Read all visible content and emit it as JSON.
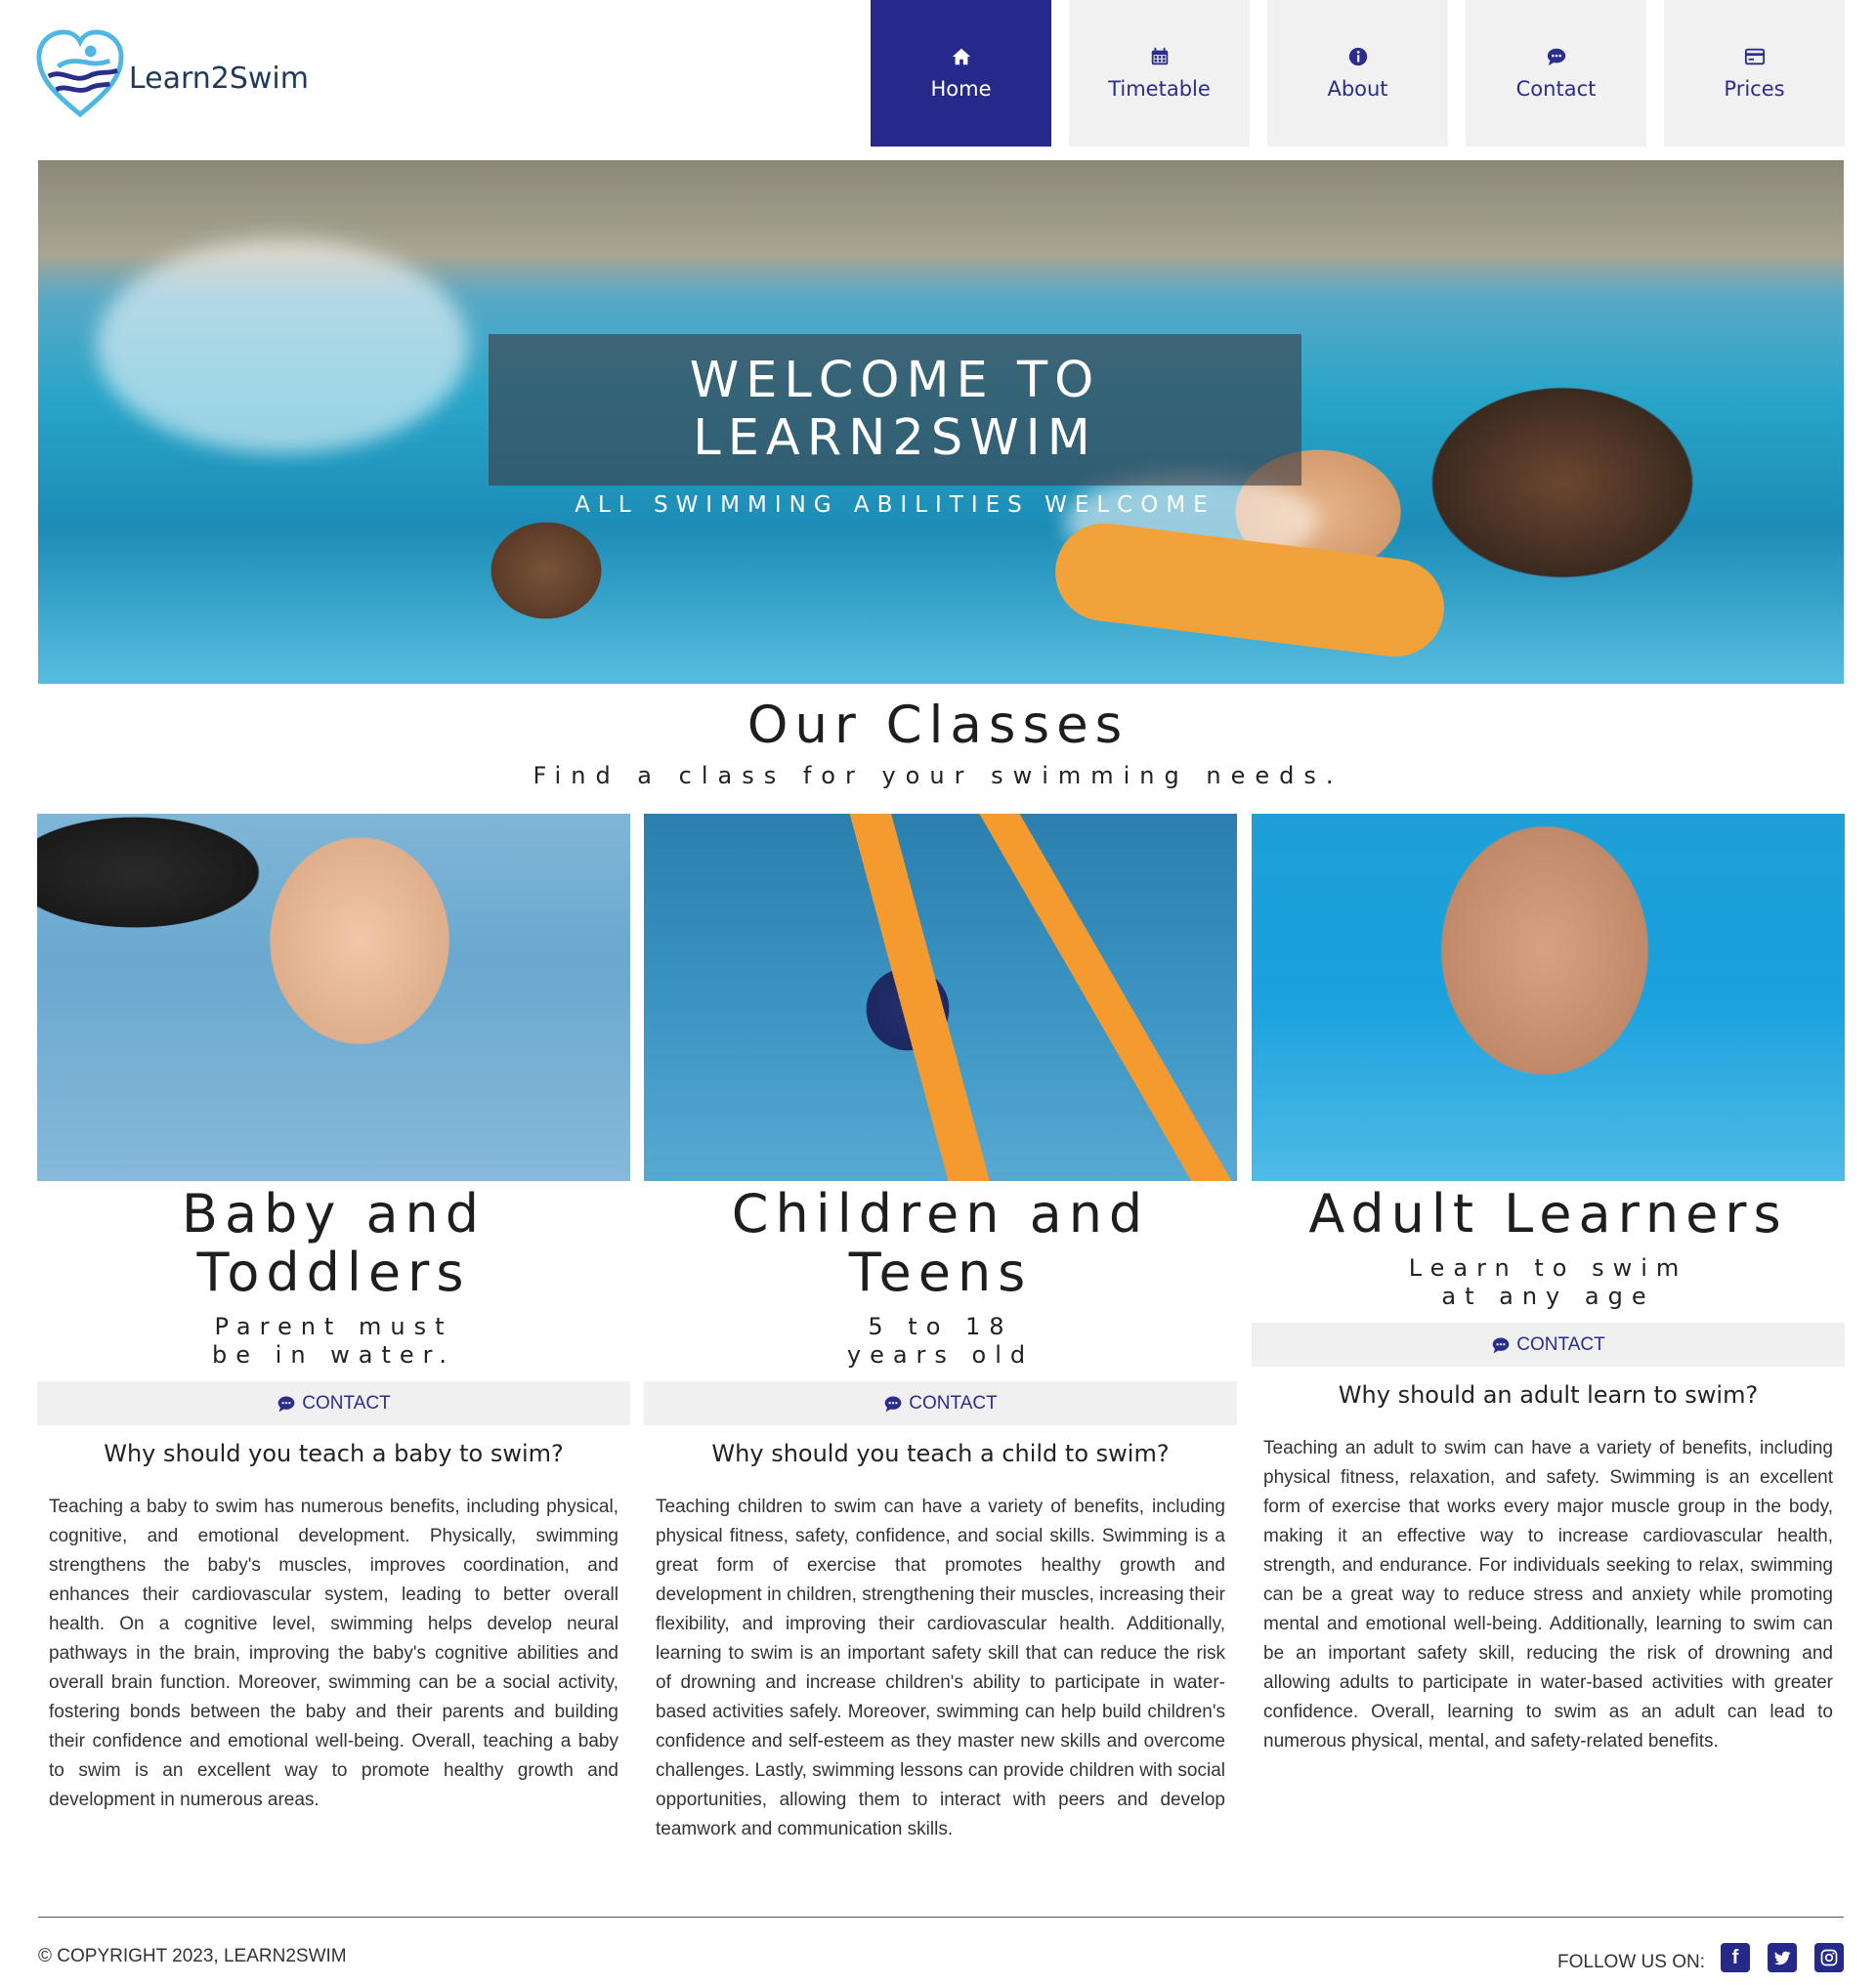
{
  "brand": {
    "name": "Learn2Swim"
  },
  "nav": [
    {
      "label": "Home",
      "icon": "home-icon",
      "active": true
    },
    {
      "label": "Timetable",
      "icon": "calendar-icon",
      "active": false
    },
    {
      "label": "About",
      "icon": "info-icon",
      "active": false
    },
    {
      "label": "Contact",
      "icon": "chat-icon",
      "active": false
    },
    {
      "label": "Prices",
      "icon": "credit-card-icon",
      "active": false
    }
  ],
  "hero": {
    "title": "WELCOME TO LEARN2SWIM",
    "subtitle": "ALL SWIMMING ABILITIES WELCOME"
  },
  "classes": {
    "title": "Our Classes",
    "subtitle": "Find a class for your swimming needs.",
    "cards": [
      {
        "title": "Baby and Toddlers",
        "tagline": "Parent must be in water.",
        "contact_label": "CONTACT",
        "question": "Why should you teach a baby to swim?",
        "body": "Teaching a baby to swim has numerous benefits, including physical, cognitive, and emotional development. Physically, swimming strengthens the baby's muscles, improves coordination, and enhances their cardiovascular system, leading to better overall health. On a cognitive level, swimming helps develop neural pathways in the brain, improving the baby's cognitive abilities and overall brain function. Moreover, swimming can be a social activity, fostering bonds between the baby and their parents and building their confidence and emotional well-being. Overall, teaching a baby to swim is an excellent way to promote healthy growth and development in numerous areas."
      },
      {
        "title": "Children and Teens",
        "tagline": "5 to 18 years old",
        "contact_label": "CONTACT",
        "question": "Why should you teach a child to swim?",
        "body": "Teaching children to swim can have a variety of benefits, including physical fitness, safety, confidence, and social skills. Swimming is a great form of exercise that promotes healthy growth and development in children, strengthening their muscles, increasing their flexibility, and improving their cardiovascular health. Additionally, learning to swim is an important safety skill that can reduce the risk of drowning and increase children's ability to participate in water-based activities safely. Moreover, swimming can help build children's confidence and self-esteem as they master new skills and overcome challenges. Lastly, swimming lessons can provide children with social opportunities, allowing them to interact with peers and develop teamwork and communication skills."
      },
      {
        "title": "Adult Learners",
        "tagline": "Learn to swim at any age",
        "contact_label": "CONTACT",
        "question": "Why should an adult learn to swim?",
        "body": "Teaching an adult to swim can have a variety of benefits, including physical fitness, relaxation, and safety. Swimming is an excellent form of exercise that works every major muscle group in the body, making it an effective way to increase cardiovascular health, strength, and endurance. For individuals seeking to relax, swimming can be a great way to reduce stress and anxiety while promoting mental and emotional well-being. Additionally, learning to swim can be an important safety skill, reducing the risk of drowning and allowing adults to participate in water-based activities with greater confidence. Overall, learning to swim as an adult can lead to numerous physical, mental, and safety-related benefits."
      }
    ]
  },
  "footer": {
    "copyright": "© COPYRIGHT 2023, LEARN2SWIM",
    "follow_label": "FOLLOW US ON:",
    "socials": [
      "facebook-icon",
      "twitter-icon",
      "instagram-icon"
    ]
  },
  "colors": {
    "accent": "#27298a",
    "nav_bg": "#f1f1f1",
    "contact_bg": "#f0f0f0"
  }
}
